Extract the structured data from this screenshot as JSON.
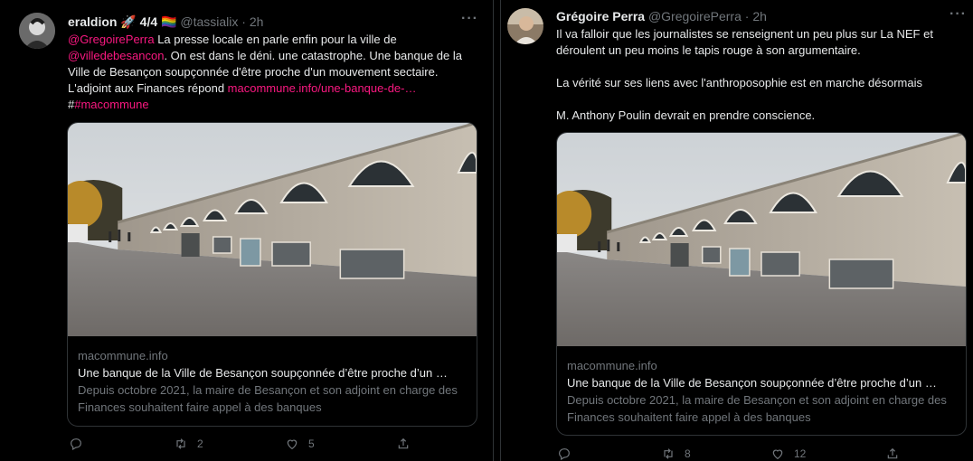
{
  "colors": {
    "background": "#000000",
    "text": "#e7e9ea",
    "muted": "#71767b",
    "accent_link": "#f91880",
    "border": "#2f3336"
  },
  "tweet1": {
    "author_name": "eraldion",
    "author_badges": "🚀 4/4 🏳️‍🌈",
    "handle": "@tassialix",
    "separator": "·",
    "time": "2h",
    "more_icon": "more-horizontal-icon",
    "mention_1": "@GregoirePerra",
    "text_1": " La presse locale en parle enfin pour la ville de ",
    "mention_2": "@villedebesancon",
    "text_2": ". On est dans le déni. une catastrophe. Une banque de la Ville de Besançon soupçonnée d'être proche d'un mouvement sectaire. L'adjoint aux Finances répond ",
    "url": "macommune.info/une-banque-de-…",
    "hash_prefix": "#",
    "hashtag": "#macommune",
    "card": {
      "domain": "macommune.info",
      "title": "Une banque de la Ville de Besançon soupçonnée d’être proche d’un …",
      "description": "Depuis octobre 2021, la maire de Besançon et son adjoint en charge des Finances souhaitent faire appel à des banques"
    },
    "actions": {
      "reply_count": "",
      "retweet_count": "2",
      "like_count": "5",
      "share_count": ""
    }
  },
  "tweet2": {
    "author_name": "Grégoire Perra",
    "handle": "@GregoirePerra",
    "separator": "·",
    "time": "2h",
    "more_icon": "more-horizontal-icon",
    "para_1": "Il va falloir que les journalistes se renseignent un peu plus sur La NEF et déroulent un peu moins le tapis rouge à son argumentaire.",
    "para_2": "La vérité sur ses liens avec l'anthroposophie est en marche désormais",
    "para_3": "M. Anthony Poulin devrait en prendre conscience.",
    "card": {
      "domain": "macommune.info",
      "title": "Une banque de la Ville de Besançon soupçonnée d’être proche d’un …",
      "description": "Depuis octobre 2021, la maire de Besançon et son adjoint en charge des Finances souhaitent faire appel à des banques"
    },
    "actions": {
      "reply_count": "",
      "retweet_count": "8",
      "like_count": "12",
      "share_count": ""
    }
  }
}
